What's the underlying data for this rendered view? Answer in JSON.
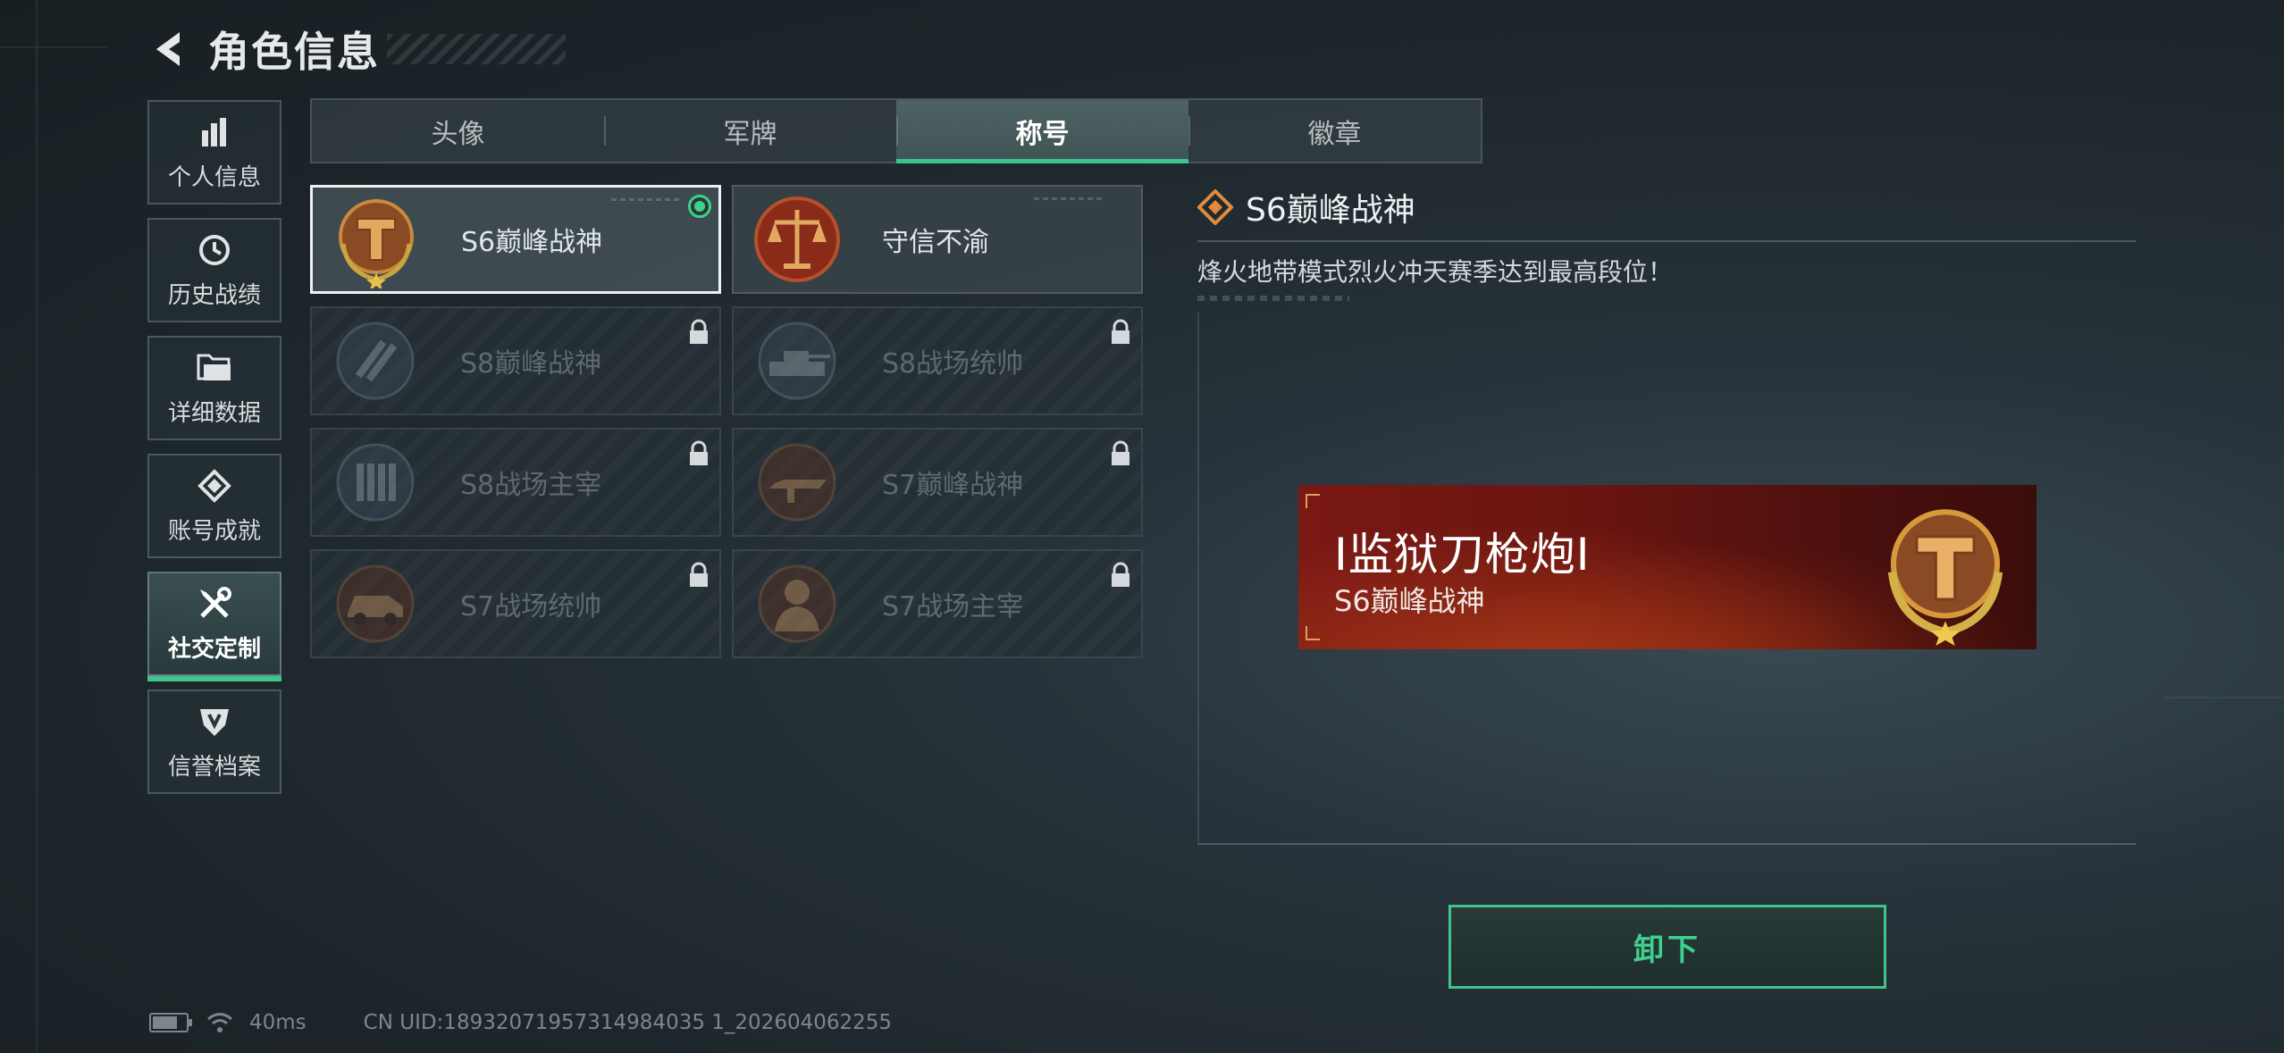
{
  "header": {
    "title": "角色信息"
  },
  "sidebar": {
    "items": [
      {
        "label": "个人信息",
        "icon": "bar-chart-icon",
        "active": false
      },
      {
        "label": "历史战绩",
        "icon": "history-clock-icon",
        "active": false
      },
      {
        "label": "详细数据",
        "icon": "folder-icon",
        "active": false
      },
      {
        "label": "账号成就",
        "icon": "achievement-icon",
        "active": false
      },
      {
        "label": "社交定制",
        "icon": "tools-icon",
        "active": true
      },
      {
        "label": "信誉档案",
        "icon": "credit-shield-icon",
        "active": false
      }
    ]
  },
  "tabs": [
    {
      "label": "头像",
      "active": false
    },
    {
      "label": "军牌",
      "active": false
    },
    {
      "label": "称号",
      "active": true
    },
    {
      "label": "徽章",
      "active": false
    }
  ],
  "titles": [
    {
      "label": "S6巅峰战神",
      "locked": false,
      "selected": true,
      "equipped": true,
      "emblem": "gold-t-laurel-emblem"
    },
    {
      "label": "守信不渝",
      "locked": false,
      "selected": false,
      "equipped": false,
      "emblem": "scales-emblem"
    },
    {
      "label": "S8巅峰战神",
      "locked": true,
      "emblem": "slash-laurel-emblem"
    },
    {
      "label": "S8战场统帅",
      "locked": true,
      "emblem": "tank-emblem"
    },
    {
      "label": "S8战场主宰",
      "locked": true,
      "emblem": "ammo-emblem"
    },
    {
      "label": "S7巅峰战神",
      "locked": true,
      "emblem": "weapon-emblem"
    },
    {
      "label": "S7战场统帅",
      "locked": true,
      "emblem": "vehicle-emblem"
    },
    {
      "label": "S7战场主宰",
      "locked": true,
      "emblem": "soldier-emblem"
    }
  ],
  "detail": {
    "title": "S6巅峰战神",
    "description": "烽火地带模式烈火冲天赛季达到最高段位！"
  },
  "nameplate": {
    "player_name": "I监狱刀枪炮I",
    "title": "S6巅峰战神"
  },
  "unequip_button": {
    "label": "卸下"
  },
  "status": {
    "ping": "40ms",
    "uid": "CN UID:18932071957314984035 1_202604062255",
    "battery_level": 0.75
  },
  "colors": {
    "accent": "#3fc48c",
    "nameplate_red": "#7a1814",
    "emblem_gold": "#c98a3c"
  }
}
